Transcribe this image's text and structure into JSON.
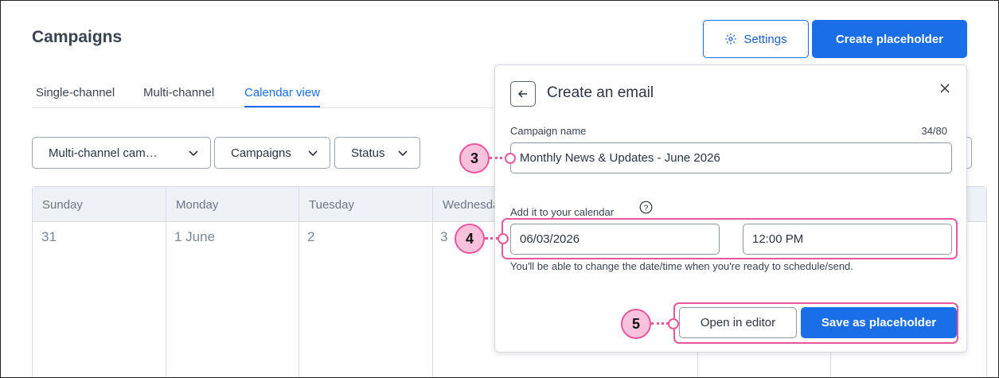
{
  "header": {
    "title": "Campaigns",
    "settings_label": "Settings",
    "create_label": "Create placeholder"
  },
  "tabs": [
    {
      "label": "Single-channel",
      "active": false
    },
    {
      "label": "Multi-channel",
      "active": false
    },
    {
      "label": "Calendar view",
      "active": true
    }
  ],
  "filters": [
    {
      "label": "Multi-channel cam…"
    },
    {
      "label": "Campaigns"
    },
    {
      "label": "Status"
    }
  ],
  "calendar": {
    "days": [
      "Sunday",
      "Monday",
      "Tuesday",
      "Wednesday"
    ],
    "dates": [
      "31",
      "1 June",
      "2",
      "3"
    ]
  },
  "popover": {
    "title": "Create an email",
    "campaign_name_label": "Campaign name",
    "campaign_name_counter": "34/80",
    "campaign_name_value": "Monthly News & Updates - June 2026",
    "calendar_label": "Add it to your calendar",
    "date_value": "06/03/2026",
    "time_value": "12:00 PM",
    "hint": "You'll be able to change the date/time when you're ready to schedule/send.",
    "open_editor_label": "Open in editor",
    "save_label": "Save as placeholder"
  },
  "callouts": [
    "3",
    "4",
    "5"
  ],
  "colors": {
    "accent": "#1a6ee8",
    "highlight": "#e8579b",
    "callout_fill": "#f8c2dc"
  },
  "icons": [
    "gear-icon",
    "chevron-down-icon",
    "arrow-left-icon",
    "close-icon",
    "help-icon"
  ]
}
